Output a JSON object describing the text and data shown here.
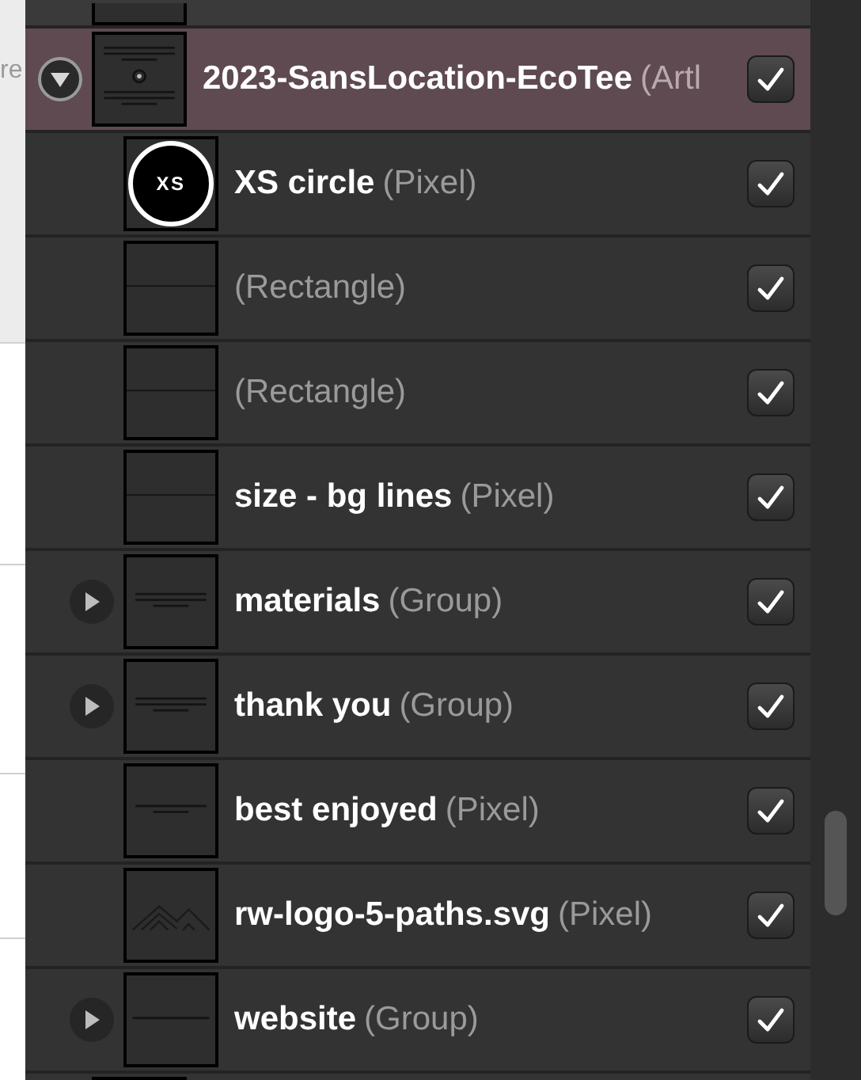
{
  "background_panel": {
    "text": "re"
  },
  "layers": [
    {
      "name": "2023-SansLocation-EcoTee",
      "type": "(Artl",
      "kind": "artboard",
      "selected": true,
      "expanded": true,
      "visible": true,
      "children": [
        {
          "name": "XS circle",
          "type": "(Pixel)",
          "kind": "badge",
          "thumbnail_text": "XS",
          "selected": false,
          "visible": true
        },
        {
          "type": "(Rectangle)",
          "kind": "rule",
          "selected": false,
          "visible": true
        },
        {
          "type": "(Rectangle)",
          "kind": "rule",
          "selected": false,
          "visible": true
        },
        {
          "name": "size - bg lines",
          "type": "(Pixel)",
          "kind": "rule",
          "selected": false,
          "visible": true
        },
        {
          "name": "materials",
          "type": "(Group)",
          "kind": "text3",
          "selected": false,
          "expanded": false,
          "visible": true
        },
        {
          "name": "thank you",
          "type": "(Group)",
          "kind": "text3",
          "selected": false,
          "expanded": false,
          "visible": true
        },
        {
          "name": "best enjoyed",
          "type": "(Pixel)",
          "kind": "text2",
          "selected": false,
          "visible": true
        },
        {
          "name": "rw-logo-5-paths.svg",
          "type": "(Pixel)",
          "kind": "logo",
          "selected": false,
          "visible": true
        },
        {
          "name": "website",
          "type": "(Group)",
          "kind": "text1",
          "selected": false,
          "expanded": false,
          "visible": true
        }
      ]
    }
  ]
}
